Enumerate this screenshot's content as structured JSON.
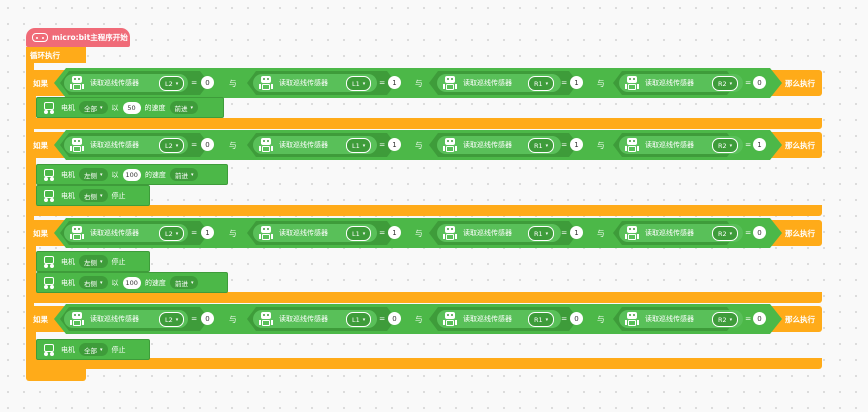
{
  "hat": {
    "label": "micro:bit主程序开始",
    "icon": "microbit-icon"
  },
  "loop": {
    "label": "循环执行"
  },
  "blocks": [
    {
      "if_label": "如果",
      "then_label": "那么执行",
      "and_label": "与",
      "sensors": [
        {
          "label": "读取巡线传感器",
          "port": "L2",
          "op": "=",
          "value": "0"
        },
        {
          "label": "读取巡线传感器",
          "port": "L1",
          "op": "=",
          "value": "1"
        },
        {
          "label": "读取巡线传感器",
          "port": "R1",
          "op": "=",
          "value": "1"
        },
        {
          "label": "读取巡线传感器",
          "port": "R2",
          "op": "=",
          "value": "0"
        }
      ],
      "motors": [
        {
          "label": "电机",
          "side": "全部",
          "speed_prefix": "以",
          "speed": "50",
          "speed_suffix": "的速度",
          "dir": "前进"
        }
      ]
    },
    {
      "if_label": "如果",
      "then_label": "那么执行",
      "and_label": "与",
      "sensors": [
        {
          "label": "读取巡线传感器",
          "port": "L2",
          "op": "=",
          "value": "0"
        },
        {
          "label": "读取巡线传感器",
          "port": "L1",
          "op": "=",
          "value": "1"
        },
        {
          "label": "读取巡线传感器",
          "port": "R1",
          "op": "=",
          "value": "1"
        },
        {
          "label": "读取巡线传感器",
          "port": "R2",
          "op": "=",
          "value": "1"
        }
      ],
      "motors": [
        {
          "label": "电机",
          "side": "左侧",
          "speed_prefix": "以",
          "speed": "100",
          "speed_suffix": "的速度",
          "dir": "前进"
        },
        {
          "label": "电机",
          "side": "右侧",
          "stop": "停止"
        }
      ]
    },
    {
      "if_label": "如果",
      "then_label": "那么执行",
      "and_label": "与",
      "sensors": [
        {
          "label": "读取巡线传感器",
          "port": "L2",
          "op": "=",
          "value": "1"
        },
        {
          "label": "读取巡线传感器",
          "port": "L1",
          "op": "=",
          "value": "1"
        },
        {
          "label": "读取巡线传感器",
          "port": "R1",
          "op": "=",
          "value": "1"
        },
        {
          "label": "读取巡线传感器",
          "port": "R2",
          "op": "=",
          "value": "0"
        }
      ],
      "motors": [
        {
          "label": "电机",
          "side": "左侧",
          "stop": "停止"
        },
        {
          "label": "电机",
          "side": "右侧",
          "speed_prefix": "以",
          "speed": "100",
          "speed_suffix": "的速度",
          "dir": "前进"
        }
      ]
    },
    {
      "if_label": "如果",
      "then_label": "那么执行",
      "and_label": "与",
      "sensors": [
        {
          "label": "读取巡线传感器",
          "port": "L2",
          "op": "=",
          "value": "0"
        },
        {
          "label": "读取巡线传感器",
          "port": "L1",
          "op": "=",
          "value": "0"
        },
        {
          "label": "读取巡线传感器",
          "port": "R1",
          "op": "=",
          "value": "0"
        },
        {
          "label": "读取巡线传感器",
          "port": "R2",
          "op": "=",
          "value": "0"
        }
      ],
      "motors": [
        {
          "label": "电机",
          "side": "全部",
          "stop": "停止"
        }
      ]
    }
  ],
  "colors": {
    "orange": "#ffab19",
    "green": "#4cb848",
    "green_dark": "#3e9c3a",
    "hat": "#f06b78"
  }
}
